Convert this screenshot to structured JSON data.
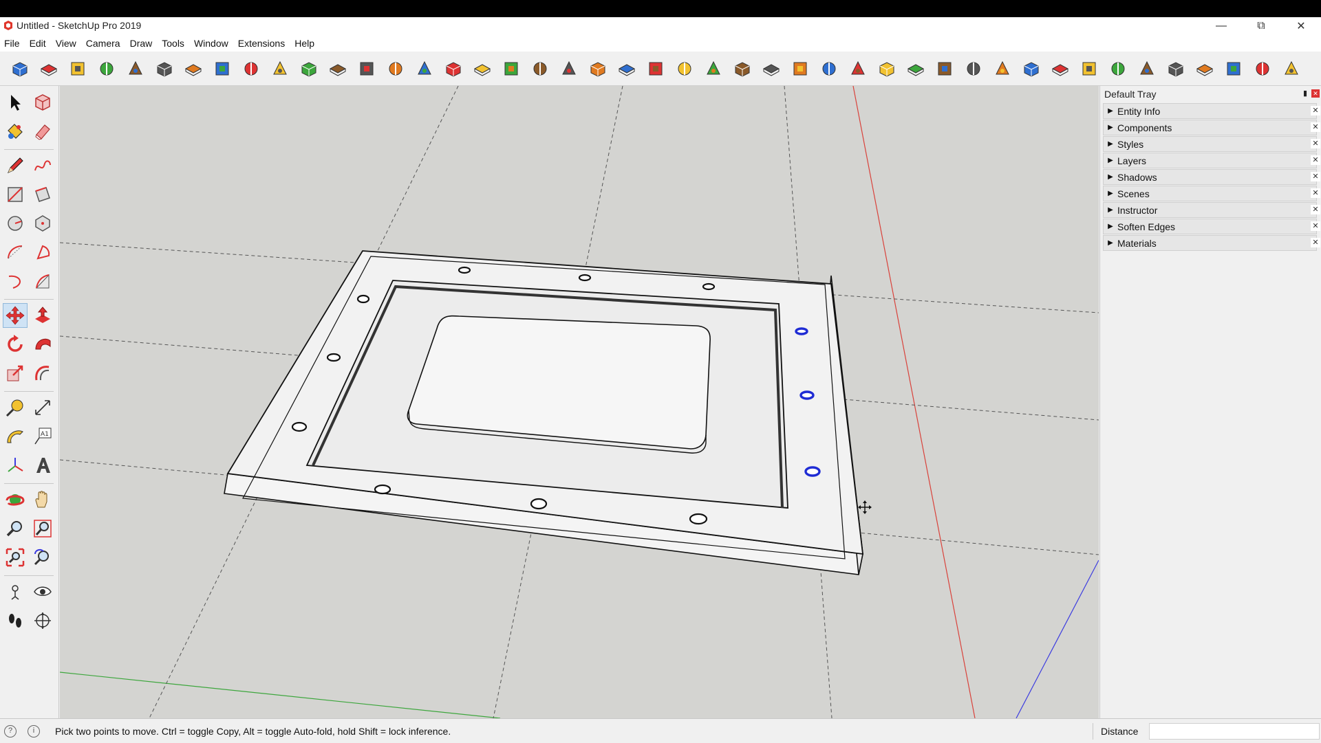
{
  "window": {
    "title": "Untitled - SketchUp Pro 2019"
  },
  "menu": [
    "File",
    "Edit",
    "View",
    "Camera",
    "Draw",
    "Tools",
    "Window",
    "Extensions",
    "Help"
  ],
  "tray": {
    "title": "Default Tray",
    "items": [
      "Entity Info",
      "Components",
      "Styles",
      "Layers",
      "Shadows",
      "Scenes",
      "Instructor",
      "Soften Edges",
      "Materials"
    ]
  },
  "status": {
    "message": "Pick two points to move.  Ctrl = toggle Copy, Alt = toggle Auto-fold, hold Shift = lock inference.",
    "measure_label": "Distance",
    "measure_value": ""
  },
  "active_tool": "move-tool",
  "icons_top": [
    "model-info-icon",
    "views-icon",
    "home-view-icon",
    "front-view-icon",
    "house-icon",
    "back-view-icon",
    "iso-view-icon",
    "top-view-icon",
    "front-face-view-icon",
    "right-view-icon",
    "back-face-view-icon",
    "left-view-icon",
    "follow-me-icon",
    "push-pull-icon",
    "section-plane-icon",
    "paint-icon",
    "texture-icon",
    "link-icon",
    "offset-icon",
    "bezier-icon",
    "add-plus-icon",
    "green-plus-icon",
    "intersect-icon",
    "cone-icon",
    "sandbox-icon",
    "warp-icon",
    "torus-icon",
    "orbit-icon",
    "cycle-icon",
    "axes-icon",
    "component-icon",
    "undo-rotate-icon",
    "scale-color-icon",
    "solid-tools-icon",
    "union-icon",
    "subtract-icon",
    "target-icon",
    "align-icon",
    "layers-toolbar-icon",
    "shadows-toolbar-icon",
    "grid-icon",
    "grid2-icon",
    "explode-icon",
    "curve-icon",
    "extra-icon"
  ],
  "colors": {
    "viewport_bg": "#d4d4d1",
    "red_axis": "#d9413a",
    "green_axis": "#3ca63c",
    "blue_axis": "#3b3be0",
    "highlight": "#1f2cd4"
  }
}
